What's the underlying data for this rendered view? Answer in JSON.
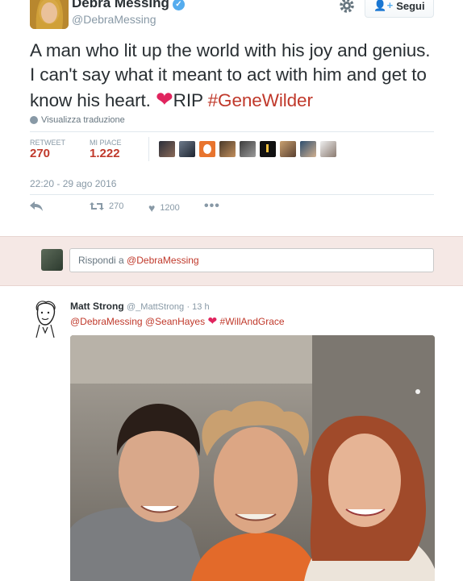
{
  "tweet": {
    "display_name": "Debra Messing",
    "handle": "@DebraMessing",
    "verified_icon": "verified-check-icon",
    "text_main": "A man who lit up the world with his joy and genius. I can't say what it meant to act with him and get to know his heart.",
    "text_rip": "RIP",
    "hashtag": "#GeneWilder",
    "translate_label": "Visualizza traduzione",
    "timestamp": "22:20 - 29 ago 2016"
  },
  "header": {
    "follow_label": "Segui",
    "follow_icon": "add-person-icon",
    "settings_icon": "gear-icon"
  },
  "stats": {
    "retweets_label": "RETWEET",
    "retweets_value": "270",
    "likes_label": "MI PIACE",
    "likes_value": "1.222"
  },
  "actions": {
    "reply_icon": "reply-icon",
    "retweet_icon": "retweet-icon",
    "retweet_count": "270",
    "like_icon": "heart-icon",
    "like_count": "1200",
    "more_icon": "more-icon"
  },
  "reply_box": {
    "prefix": "Rispondi a ",
    "mention": "@DebraMessing"
  },
  "reply_tweet": {
    "display_name": "Matt Strong",
    "handle": "@_MattStrong",
    "age": "· 13 h",
    "mentions": "@DebraMessing @SeanHayes",
    "hashtag": "#WillAndGrace"
  },
  "colors": {
    "accent": "#c0392b",
    "heart": "#e0245e",
    "verified": "#55acee",
    "reply_bg": "#f5e8e5"
  }
}
